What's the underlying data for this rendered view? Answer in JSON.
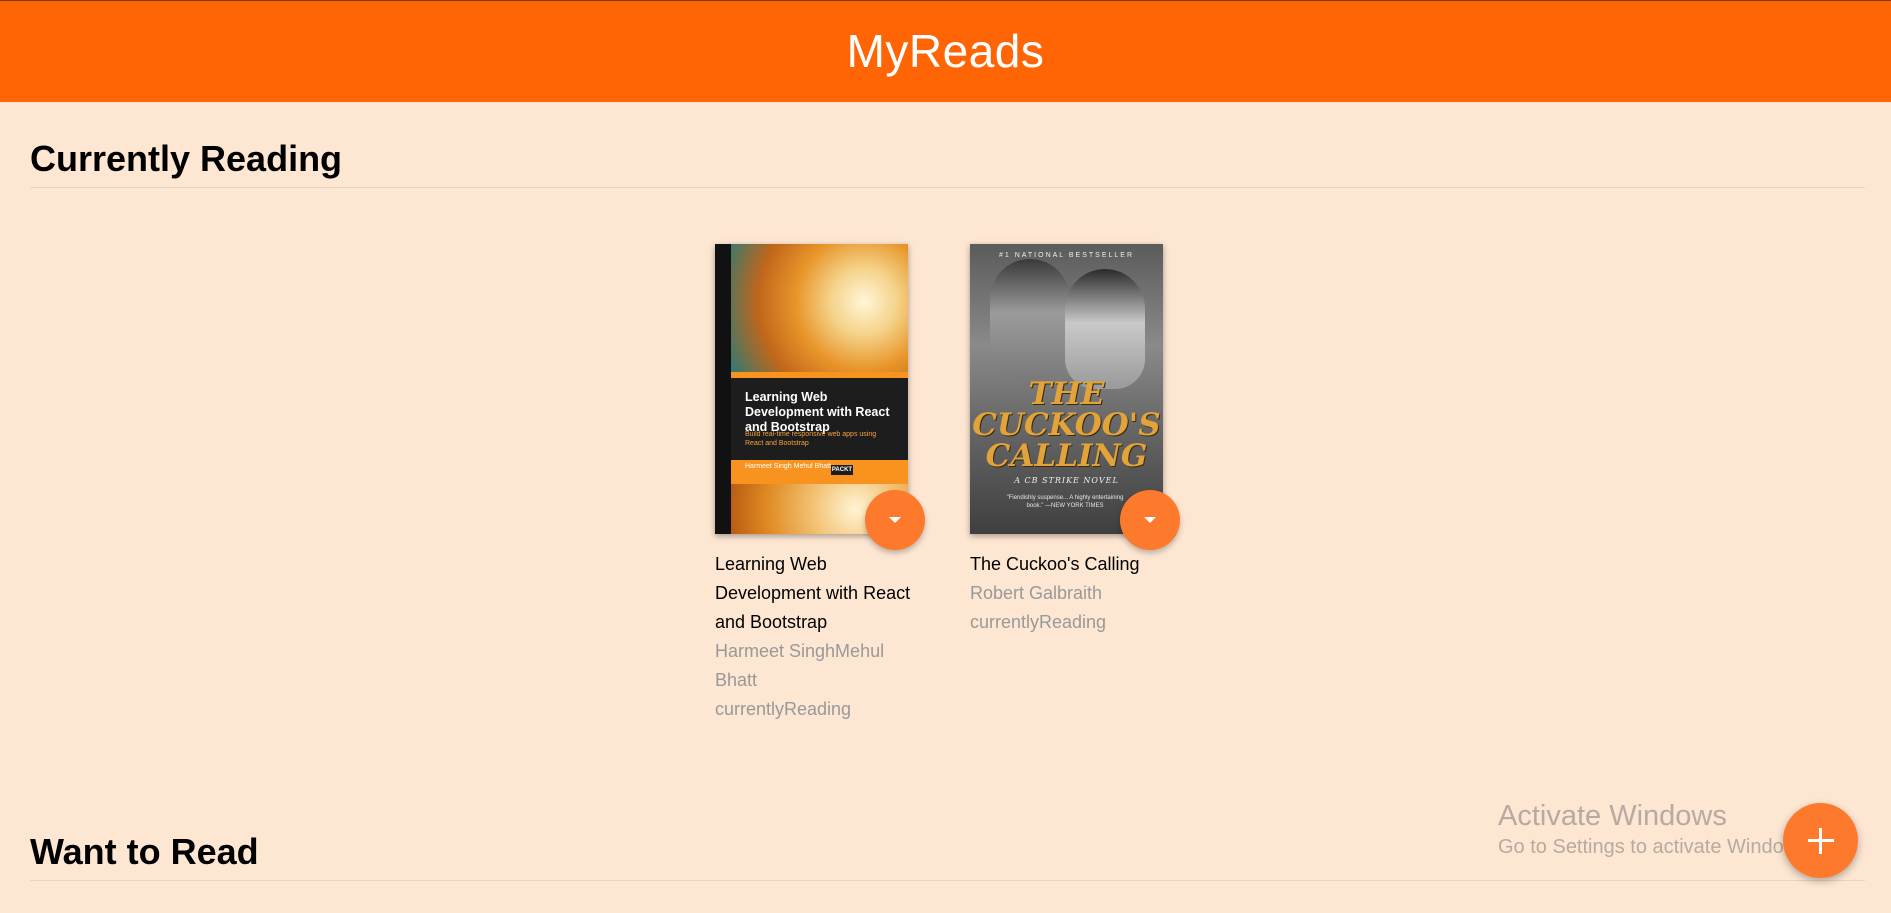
{
  "header": {
    "title": "MyReads"
  },
  "shelves": [
    {
      "title": "Currently Reading",
      "books": [
        {
          "title": "Learning Web Development with React and Bootstrap",
          "authors": "Harmeet SinghMehul Bhatt",
          "shelf": "currentlyReading"
        },
        {
          "title": "The Cuckoo's Calling",
          "authors": "Robert Galbraith",
          "shelf": "currentlyReading"
        }
      ]
    },
    {
      "title": "Want to Read",
      "books": []
    }
  ],
  "covers": {
    "book0": {
      "title": "Learning Web Development with React and Bootstrap",
      "subtitle": "Build real-time responsive web apps using React and Bootstrap",
      "authors": "Harmeet Singh Mehul Bhatt",
      "publisher": "PACKT"
    },
    "book1": {
      "badge": "#1 NATIONAL BESTSELLER",
      "title": "THE CUCKOO'S CALLING",
      "subtitle": "A CB STRIKE NOVEL",
      "quote": "\"Fiendishly suspense... A highly entertaining book.\" —NEW YORK TIMES"
    }
  },
  "watermark": {
    "line1": "Activate Windows",
    "line2": "Go to Settings to activate Windows."
  },
  "icons": {
    "shelf_changer": "caret-down-icon",
    "add": "plus-icon"
  },
  "colors": {
    "header_bg": "#ff6505",
    "page_bg": "#fde6d2",
    "accent": "#fd7a2c"
  }
}
